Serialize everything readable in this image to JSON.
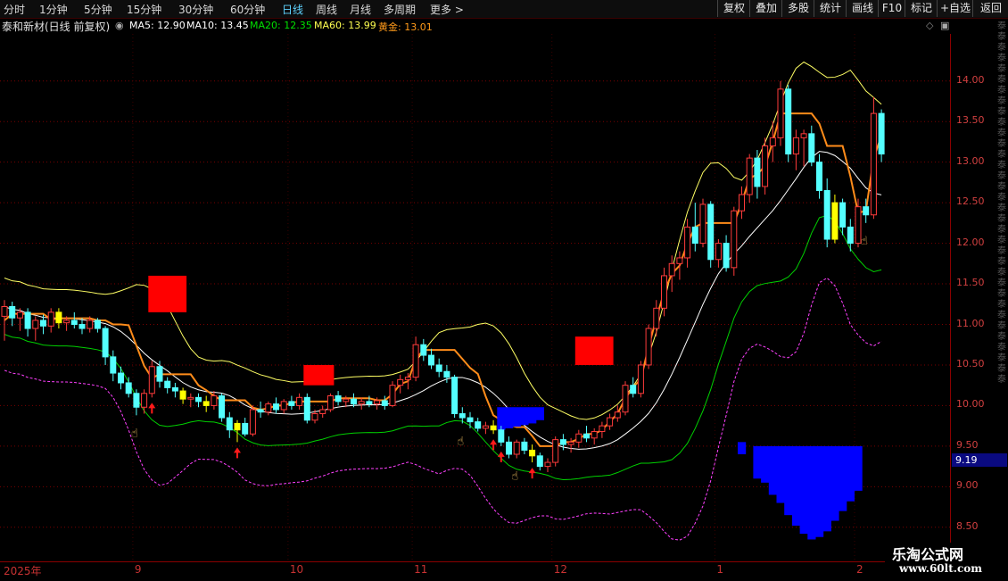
{
  "toolbar": {
    "tabs": [
      "分时",
      "1分钟",
      "5分钟",
      "15分钟",
      "30分钟",
      "60分钟",
      "日线",
      "周线",
      "月线",
      "多周期",
      "更多 >"
    ],
    "active_tab": "日线",
    "right_buttons": [
      "复权",
      "叠加",
      "多股",
      "统计",
      "画线",
      "F10",
      "标记",
      "+自选",
      "返回"
    ]
  },
  "info": {
    "title": "泰和新材(日线 前复权)",
    "ma5": "MA5: 12.90",
    "ma10": "MA10: 13.45",
    "ma20": "MA20: 12.35",
    "ma60": "MA60: 13.99",
    "gold": "黄金: 13.01"
  },
  "colors": {
    "up": "#ff3b3b",
    "down": "#54ffff",
    "ma5": "#ffffff",
    "ma20": "#00d000",
    "upper_band": "#ffff64",
    "orange_line": "#ff8c1a",
    "lower_dashed": "#ff40ff",
    "red_block": "#ff0000",
    "blue_block": "#0000ff",
    "grid": "#7a0000"
  },
  "current_price_label": "9.19",
  "side_strip_text": "泰泰泰泰泰泰泰泰泰泰泰泰泰泰泰泰泰泰泰泰泰泰泰泰泰泰泰泰泰泰泰泰泰泰",
  "watermark": {
    "line1": "乐淘公式网",
    "line2": "www.60lt.com"
  },
  "chart_data": {
    "type": "candlestick",
    "y_ticks": [
      14.0,
      13.5,
      13.0,
      12.5,
      12.0,
      11.5,
      11.0,
      10.5,
      10.0,
      9.5,
      9.0,
      8.5
    ],
    "y_tick_labels": [
      "14.00",
      "13.50",
      "13.00",
      "12.50",
      "12.00",
      "11.50",
      "11.00",
      "10.50",
      "10.00",
      "9.50",
      "9.00",
      "8.50"
    ],
    "ylim": [
      8.08,
      14.58
    ],
    "date_labels": [
      {
        "label": "2025年",
        "index": 0
      },
      {
        "label": "9",
        "index": 17
      },
      {
        "label": "10",
        "index": 37
      },
      {
        "label": "11",
        "index": 53
      },
      {
        "label": "12",
        "index": 71
      },
      {
        "label": "1",
        "index": 92
      },
      {
        "label": "2",
        "index": 110
      }
    ],
    "candles": [
      [
        11.1,
        11.3,
        10.8,
        11.22
      ],
      [
        11.22,
        11.28,
        10.98,
        11.08
      ],
      [
        11.08,
        11.2,
        10.92,
        11.15
      ],
      [
        11.15,
        11.2,
        10.85,
        10.95
      ],
      [
        10.95,
        11.1,
        10.8,
        11.05
      ],
      [
        11.05,
        11.12,
        10.88,
        10.98
      ],
      [
        10.98,
        11.2,
        10.9,
        11.15
      ],
      [
        11.15,
        11.2,
        10.95,
        11.02
      ],
      [
        11.02,
        11.1,
        10.92,
        11.05
      ],
      [
        11.05,
        11.15,
        10.95,
        11.0
      ],
      [
        11.0,
        11.08,
        10.88,
        10.95
      ],
      [
        10.95,
        11.1,
        10.9,
        11.05
      ],
      [
        11.05,
        11.08,
        10.9,
        10.95
      ],
      [
        10.95,
        10.98,
        10.5,
        10.6
      ],
      [
        10.6,
        10.68,
        10.3,
        10.4
      ],
      [
        10.4,
        10.48,
        10.2,
        10.28
      ],
      [
        10.28,
        10.35,
        10.1,
        10.15
      ],
      [
        10.15,
        10.2,
        9.88,
        9.98
      ],
      [
        9.98,
        10.2,
        9.9,
        10.15
      ],
      [
        10.15,
        10.55,
        10.1,
        10.48
      ],
      [
        10.48,
        10.55,
        10.22,
        10.3
      ],
      [
        10.3,
        10.35,
        10.15,
        10.22
      ],
      [
        10.22,
        10.28,
        10.1,
        10.18
      ],
      [
        10.18,
        10.22,
        10.02,
        10.08
      ],
      [
        10.08,
        10.15,
        9.98,
        10.1
      ],
      [
        10.1,
        10.15,
        9.98,
        10.05
      ],
      [
        10.05,
        10.12,
        9.92,
        10.0
      ],
      [
        10.0,
        10.18,
        9.95,
        10.12
      ],
      [
        10.12,
        10.15,
        9.8,
        9.85
      ],
      [
        9.85,
        9.92,
        9.6,
        9.7
      ],
      [
        9.7,
        9.82,
        9.55,
        9.78
      ],
      [
        9.78,
        9.85,
        9.62,
        9.65
      ],
      [
        9.65,
        10.0,
        9.62,
        9.95
      ],
      [
        9.95,
        10.05,
        9.85,
        9.92
      ],
      [
        9.92,
        10.05,
        9.88,
        10.02
      ],
      [
        10.02,
        10.1,
        9.9,
        9.95
      ],
      [
        9.95,
        10.08,
        9.9,
        10.05
      ],
      [
        10.05,
        10.12,
        9.95,
        10.0
      ],
      [
        10.0,
        10.15,
        9.95,
        10.1
      ],
      [
        10.1,
        10.15,
        9.78,
        9.82
      ],
      [
        9.82,
        9.95,
        9.78,
        9.9
      ],
      [
        9.9,
        10.0,
        9.85,
        9.95
      ],
      [
        9.95,
        10.15,
        9.92,
        10.12
      ],
      [
        10.12,
        10.18,
        10.0,
        10.05
      ],
      [
        10.05,
        10.12,
        9.98,
        10.08
      ],
      [
        10.08,
        10.15,
        9.98,
        10.02
      ],
      [
        10.02,
        10.1,
        9.95,
        10.05
      ],
      [
        10.05,
        10.12,
        9.98,
        10.02
      ],
      [
        10.02,
        10.1,
        9.95,
        10.06
      ],
      [
        10.06,
        10.12,
        9.95,
        10.0
      ],
      [
        10.0,
        10.3,
        9.98,
        10.25
      ],
      [
        10.25,
        10.38,
        10.15,
        10.32
      ],
      [
        10.32,
        10.4,
        10.2,
        10.35
      ],
      [
        10.35,
        10.85,
        10.3,
        10.75
      ],
      [
        10.75,
        10.82,
        10.55,
        10.62
      ],
      [
        10.62,
        10.7,
        10.45,
        10.5
      ],
      [
        10.5,
        10.58,
        10.35,
        10.42
      ],
      [
        10.42,
        10.5,
        10.28,
        10.35
      ],
      [
        10.35,
        10.38,
        9.85,
        9.9
      ],
      [
        9.9,
        9.98,
        9.78,
        9.85
      ],
      [
        9.85,
        9.92,
        9.72,
        9.8
      ],
      [
        9.8,
        9.85,
        9.68,
        9.72
      ],
      [
        9.72,
        9.8,
        9.65,
        9.75
      ],
      [
        9.75,
        9.82,
        9.65,
        9.7
      ],
      [
        9.7,
        9.75,
        9.5,
        9.55
      ],
      [
        9.55,
        9.62,
        9.35,
        9.4
      ],
      [
        9.4,
        9.58,
        9.35,
        9.55
      ],
      [
        9.55,
        9.6,
        9.4,
        9.45
      ],
      [
        9.45,
        9.52,
        9.3,
        9.38
      ],
      [
        9.38,
        9.42,
        9.2,
        9.25
      ],
      [
        9.25,
        9.35,
        9.18,
        9.3
      ],
      [
        9.3,
        9.62,
        9.25,
        9.58
      ],
      [
        9.58,
        9.65,
        9.45,
        9.52
      ],
      [
        9.52,
        9.6,
        9.42,
        9.55
      ],
      [
        9.55,
        9.7,
        9.48,
        9.65
      ],
      [
        9.65,
        9.75,
        9.55,
        9.6
      ],
      [
        9.6,
        9.72,
        9.52,
        9.68
      ],
      [
        9.68,
        9.8,
        9.6,
        9.75
      ],
      [
        9.75,
        9.9,
        9.7,
        9.85
      ],
      [
        9.85,
        10.0,
        9.8,
        9.92
      ],
      [
        9.92,
        10.3,
        9.88,
        10.25
      ],
      [
        10.25,
        10.35,
        10.1,
        10.15
      ],
      [
        10.15,
        10.55,
        10.1,
        10.5
      ],
      [
        10.5,
        11.0,
        10.45,
        10.95
      ],
      [
        10.95,
        11.3,
        10.85,
        11.2
      ],
      [
        11.2,
        11.7,
        11.1,
        11.6
      ],
      [
        11.6,
        11.85,
        11.4,
        11.75
      ],
      [
        11.75,
        11.9,
        11.55,
        11.82
      ],
      [
        11.82,
        12.3,
        11.7,
        12.2
      ],
      [
        12.2,
        12.5,
        11.9,
        12.0
      ],
      [
        12.0,
        12.55,
        11.95,
        12.48
      ],
      [
        12.48,
        12.52,
        11.7,
        11.8
      ],
      [
        11.8,
        12.05,
        11.7,
        12.0
      ],
      [
        12.0,
        12.1,
        11.65,
        11.7
      ],
      [
        11.7,
        12.45,
        11.6,
        12.4
      ],
      [
        12.4,
        12.7,
        12.3,
        12.6
      ],
      [
        12.6,
        13.1,
        12.5,
        13.05
      ],
      [
        13.05,
        13.15,
        12.55,
        12.7
      ],
      [
        12.7,
        13.3,
        12.6,
        13.2
      ],
      [
        13.2,
        13.5,
        13.0,
        13.3
      ],
      [
        13.3,
        14.0,
        13.2,
        13.9
      ],
      [
        13.9,
        13.95,
        13.0,
        13.1
      ],
      [
        13.1,
        13.4,
        12.9,
        13.3
      ],
      [
        13.3,
        13.4,
        12.95,
        13.35
      ],
      [
        13.35,
        13.45,
        12.95,
        13.0
      ],
      [
        13.0,
        13.1,
        12.55,
        12.65
      ],
      [
        12.65,
        12.8,
        11.95,
        12.05
      ],
      [
        12.05,
        12.6,
        12.0,
        12.5
      ],
      [
        12.5,
        12.55,
        12.1,
        12.2
      ],
      [
        12.2,
        12.3,
        11.9,
        12.0
      ],
      [
        12.0,
        12.55,
        11.95,
        12.45
      ],
      [
        12.45,
        12.55,
        12.25,
        12.35
      ],
      [
        12.35,
        13.8,
        12.3,
        13.6
      ],
      [
        13.6,
        13.65,
        13.0,
        13.1
      ]
    ],
    "yellow_bar_indices": [
      7,
      23,
      26,
      30,
      63,
      68,
      107
    ],
    "up_arrow_indices": [
      19,
      30,
      63,
      64,
      68
    ],
    "hand_icon_indices": [
      17,
      59,
      66,
      111
    ],
    "red_blocks": [
      {
        "from": 19,
        "to": 23,
        "bottom": 11.15,
        "top": 11.6
      },
      {
        "from": 39,
        "to": 42,
        "bottom": 10.25,
        "top": 10.5
      },
      {
        "from": 74,
        "to": 78,
        "bottom": 10.5,
        "top": 10.85
      }
    ],
    "blue_blocks": [
      {
        "from": 64,
        "to": 69,
        "top": 9.98,
        "bottoms": [
          9.7,
          9.72,
          9.74,
          9.76,
          9.78,
          9.82
        ]
      },
      {
        "from": 95,
        "to": 95,
        "top": 9.55,
        "bottoms": [
          9.4
        ]
      },
      {
        "from": 97,
        "to": 110,
        "top": 9.5,
        "bottoms": [
          9.1,
          9.05,
          8.9,
          8.8,
          8.65,
          8.52,
          8.42,
          8.35,
          8.38,
          8.45,
          8.58,
          8.7,
          8.82,
          8.95
        ]
      }
    ]
  }
}
